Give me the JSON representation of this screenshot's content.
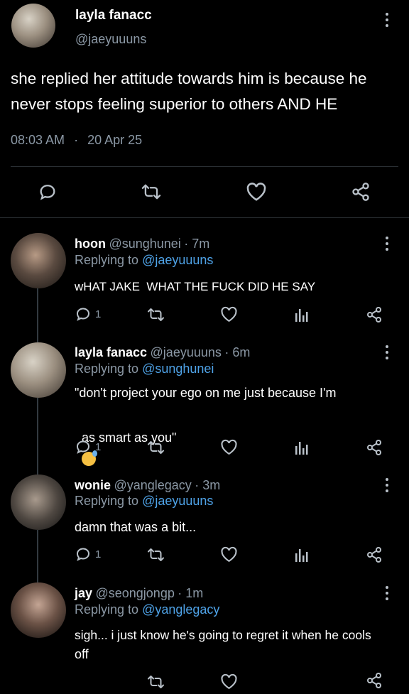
{
  "tweet": {
    "author_name": "layla fanacc",
    "author_handle": "@jaeyuuuns",
    "text_line1": "she replied her attitude towards him is because he",
    "text_line2": "never stops feeling superior to others AND HE",
    "time": "08:03 AM",
    "dot": "·",
    "date": "20 Apr 25"
  },
  "replies": [
    {
      "name": "hoon",
      "handle": "@sunghunei",
      "age": "· 7m",
      "replying_prefix": "Replying to",
      "replying_to": "@jaeyuuuns",
      "text_line1": "wHAT JAKE  WHAT THE FUCK DID HE SAY",
      "text_line2": "",
      "reply_count": "1"
    },
    {
      "name": "layla fanacc",
      "handle": "@jaeyuuuns",
      "age": "· 6m",
      "replying_prefix": "Replying to",
      "replying_to": "@sunghunei",
      "text_line1": "\"don't project your ego on me just because I'm",
      "text_line2": "as smart as you\"",
      "reply_count": "1"
    },
    {
      "name": "wonie",
      "handle": "@yanglegacy",
      "age": "· 3m",
      "replying_prefix": "Replying to",
      "replying_to": "@jaeyuuuns",
      "text_line1": "damn that was a bit...",
      "text_line2": "",
      "reply_count": "1"
    },
    {
      "name": "jay",
      "handle": "@seongjongp",
      "age": "· 1m",
      "replying_prefix": "Replying to",
      "replying_to": "@yanglegacy",
      "text_line1": "sigh... i just know he's going to regret it when he cools",
      "text_line2": "off",
      "reply_count": ""
    }
  ],
  "icons": {
    "reply": "reply-icon",
    "retweet": "retweet-icon",
    "like": "heart-icon",
    "share": "share-icon",
    "analytics": "analytics-icon",
    "more": "more-options-icon"
  },
  "colors": {
    "background": "#000000",
    "text": "#ffffff",
    "muted": "#8b98a5",
    "link": "#4fa3e8"
  }
}
